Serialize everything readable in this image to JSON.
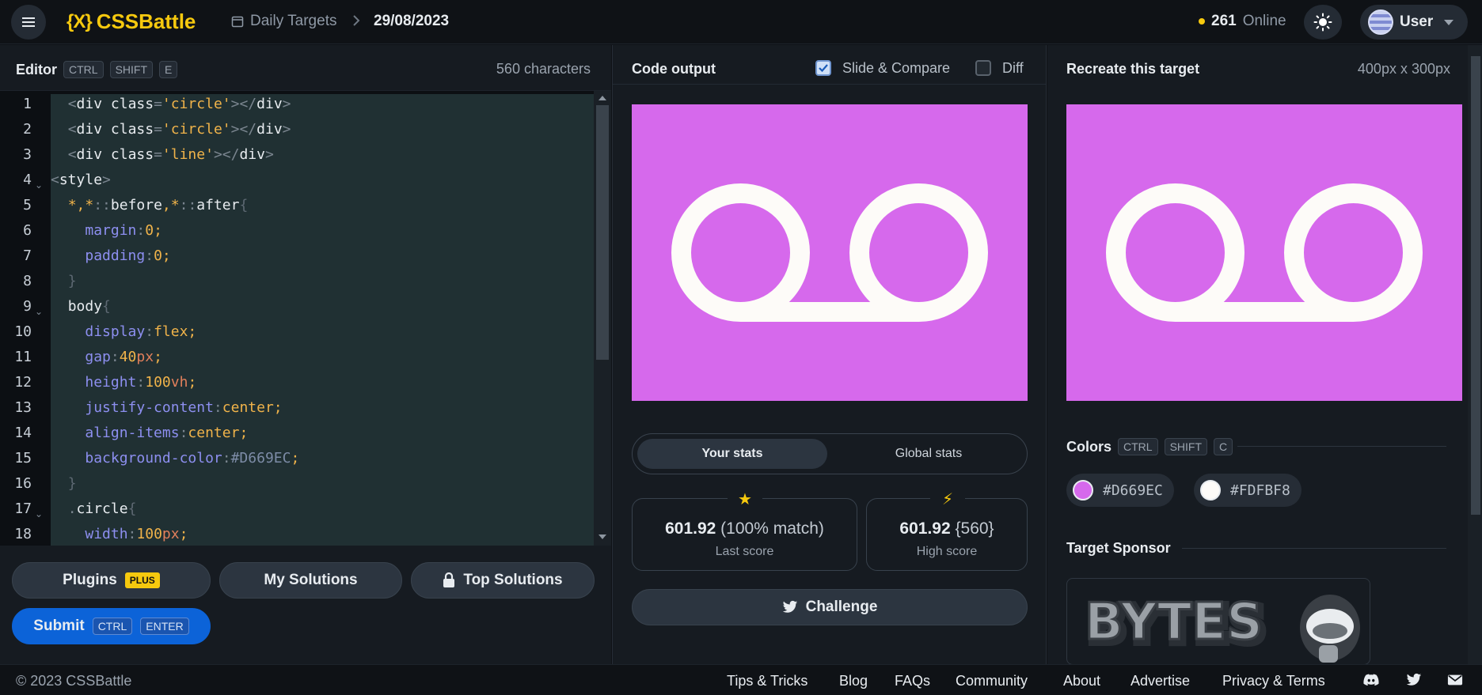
{
  "header": {
    "logo_mark": "{X}",
    "logo_text": "CSSBattle",
    "breadcrumb_1": "Daily Targets",
    "breadcrumb_2": "29/08/2023",
    "online_count": "261",
    "online_label": "Online",
    "user_name": "User"
  },
  "editor": {
    "title": "Editor",
    "shortcut_keys": [
      "CTRL",
      "SHIFT",
      "E"
    ],
    "char_count": "560 characters",
    "line_numbers": [
      "1",
      "2",
      "3",
      "4",
      "5",
      "6",
      "7",
      "8",
      "9",
      "10",
      "11",
      "12",
      "13",
      "14",
      "15",
      "16",
      "17",
      "18"
    ]
  },
  "buttons": {
    "plugins": "Plugins",
    "plugins_badge": "PLUS",
    "my_solutions": "My Solutions",
    "top_solutions": "Top Solutions",
    "submit": "Submit",
    "submit_keys": [
      "CTRL",
      "ENTER"
    ]
  },
  "output": {
    "title": "Code output",
    "slide_compare": "Slide & Compare",
    "slide_compare_checked": true,
    "diff": "Diff",
    "diff_checked": false
  },
  "stats": {
    "tab_your": "Your stats",
    "tab_global": "Global stats",
    "last_score": "601.92",
    "last_match": "(100% match)",
    "last_label": "Last score",
    "high_score": "601.92",
    "high_chars": "{560}",
    "high_label": "High score",
    "challenge": "Challenge"
  },
  "target": {
    "title": "Recreate this target",
    "size": "400px x 300px",
    "colors_title": "Colors",
    "colors_keys": [
      "CTRL",
      "SHIFT",
      "C"
    ],
    "colors": [
      {
        "hex": "#D669EC"
      },
      {
        "hex": "#FDFBF8"
      }
    ],
    "sponsor_title": "Target Sponsor",
    "sponsor_name": "BYTES"
  },
  "footer": {
    "copyright": "© 2023 CSSBattle",
    "links": [
      "Tips & Tricks",
      "Blog",
      "FAQs",
      "Community",
      "About",
      "Advertise",
      "Privacy & Terms"
    ],
    "icons": [
      "discord-icon",
      "twitter-icon",
      "mail-icon"
    ]
  }
}
